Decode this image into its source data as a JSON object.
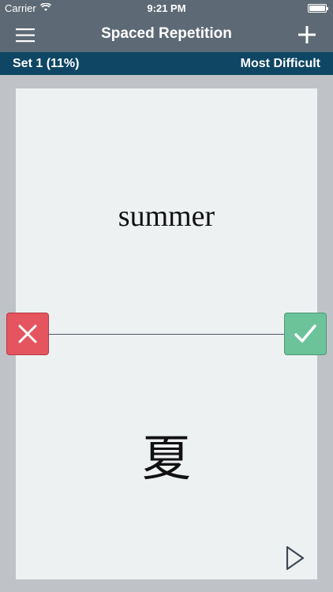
{
  "status_bar": {
    "carrier": "Carrier",
    "time": "9:21 PM"
  },
  "nav": {
    "title": "Spaced Repetition",
    "menu_icon": "hamburger-menu-icon",
    "add_icon": "plus-icon"
  },
  "set_bar": {
    "set_label": "Set 1 (11%)",
    "sort_label": "Most Difficult"
  },
  "card": {
    "front": "summer",
    "back": "夏"
  },
  "controls": {
    "wrong_icon": "x-icon",
    "right_icon": "checkmark-icon",
    "play_icon": "play-icon"
  },
  "colors": {
    "nav_bg": "#5d6a75",
    "set_bar_bg": "#0f4664",
    "card_bg": "#eef1f2",
    "wrong": "#e4555f",
    "right": "#6cc39a"
  }
}
